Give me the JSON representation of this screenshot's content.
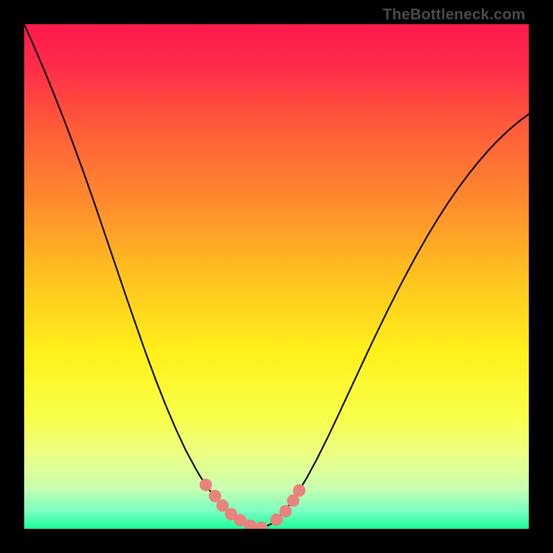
{
  "watermark": "TheBottleneck.com",
  "chart_data": {
    "type": "line",
    "title": "",
    "xlabel": "",
    "ylabel": "",
    "xlim": [
      0,
      100
    ],
    "ylim": [
      0,
      100
    ],
    "grid": false,
    "legend": false,
    "background_gradient_stops": [
      {
        "offset": 0.0,
        "color": "#ff1a4d"
      },
      {
        "offset": 0.08,
        "color": "#ff2a4a"
      },
      {
        "offset": 0.2,
        "color": "#ff5a3a"
      },
      {
        "offset": 0.35,
        "color": "#ff8a2e"
      },
      {
        "offset": 0.5,
        "color": "#ffc21f"
      },
      {
        "offset": 0.65,
        "color": "#fff11a"
      },
      {
        "offset": 0.78,
        "color": "#f8ff4a"
      },
      {
        "offset": 0.86,
        "color": "#eaff8a"
      },
      {
        "offset": 0.92,
        "color": "#c8ffb0"
      },
      {
        "offset": 0.965,
        "color": "#7affc0"
      },
      {
        "offset": 1.0,
        "color": "#1aff9a"
      }
    ],
    "series": [
      {
        "name": "bottleneck-curve",
        "color": "#000000",
        "width": 2.2,
        "x": [
          0.0,
          2.0,
          4.0,
          6.0,
          8.0,
          10.0,
          12.0,
          14.0,
          16.0,
          18.0,
          20.0,
          22.0,
          24.0,
          26.0,
          28.0,
          30.0,
          32.0,
          34.0,
          35.0,
          36.0,
          37.0,
          38.0,
          39.0,
          40.0,
          41.0,
          42.0,
          43.0,
          44.0,
          45.0,
          46.0,
          47.0,
          48.0,
          49.0,
          50.0,
          52.0,
          54.0,
          56.0,
          58.0,
          60.0,
          62.0,
          64.0,
          66.0,
          68.0,
          70.0,
          72.0,
          74.0,
          76.0,
          78.0,
          80.0,
          82.0,
          84.0,
          86.0,
          88.0,
          90.0,
          92.0,
          94.0,
          96.0,
          98.0,
          100.0
        ],
        "y": [
          100.0,
          95.5,
          90.8,
          85.9,
          80.8,
          75.5,
          70.0,
          64.3,
          58.4,
          52.5,
          46.6,
          40.8,
          35.1,
          29.7,
          24.6,
          19.9,
          15.6,
          11.9,
          10.2,
          8.7,
          7.3,
          6.0,
          4.9,
          3.9,
          2.9,
          2.1,
          1.3,
          0.7,
          0.3,
          0.1,
          0.2,
          0.5,
          1.0,
          1.8,
          4.0,
          6.8,
          10.1,
          13.8,
          17.8,
          22.0,
          26.3,
          30.6,
          34.9,
          39.1,
          43.2,
          47.2,
          51.0,
          54.7,
          58.2,
          61.5,
          64.6,
          67.5,
          70.2,
          72.7,
          75.0,
          77.1,
          79.0,
          80.7,
          82.2
        ]
      }
    ],
    "markers": {
      "name": "highlight-dots",
      "color": "#e9837d",
      "radius": 9,
      "x": [
        36.0,
        37.8,
        39.3,
        41.0,
        42.8,
        44.8,
        47.0,
        50.0,
        51.8,
        53.3,
        54.5
      ],
      "y": [
        8.7,
        6.5,
        4.6,
        2.9,
        1.7,
        0.6,
        0.2,
        1.8,
        3.5,
        5.6,
        7.6
      ]
    }
  }
}
